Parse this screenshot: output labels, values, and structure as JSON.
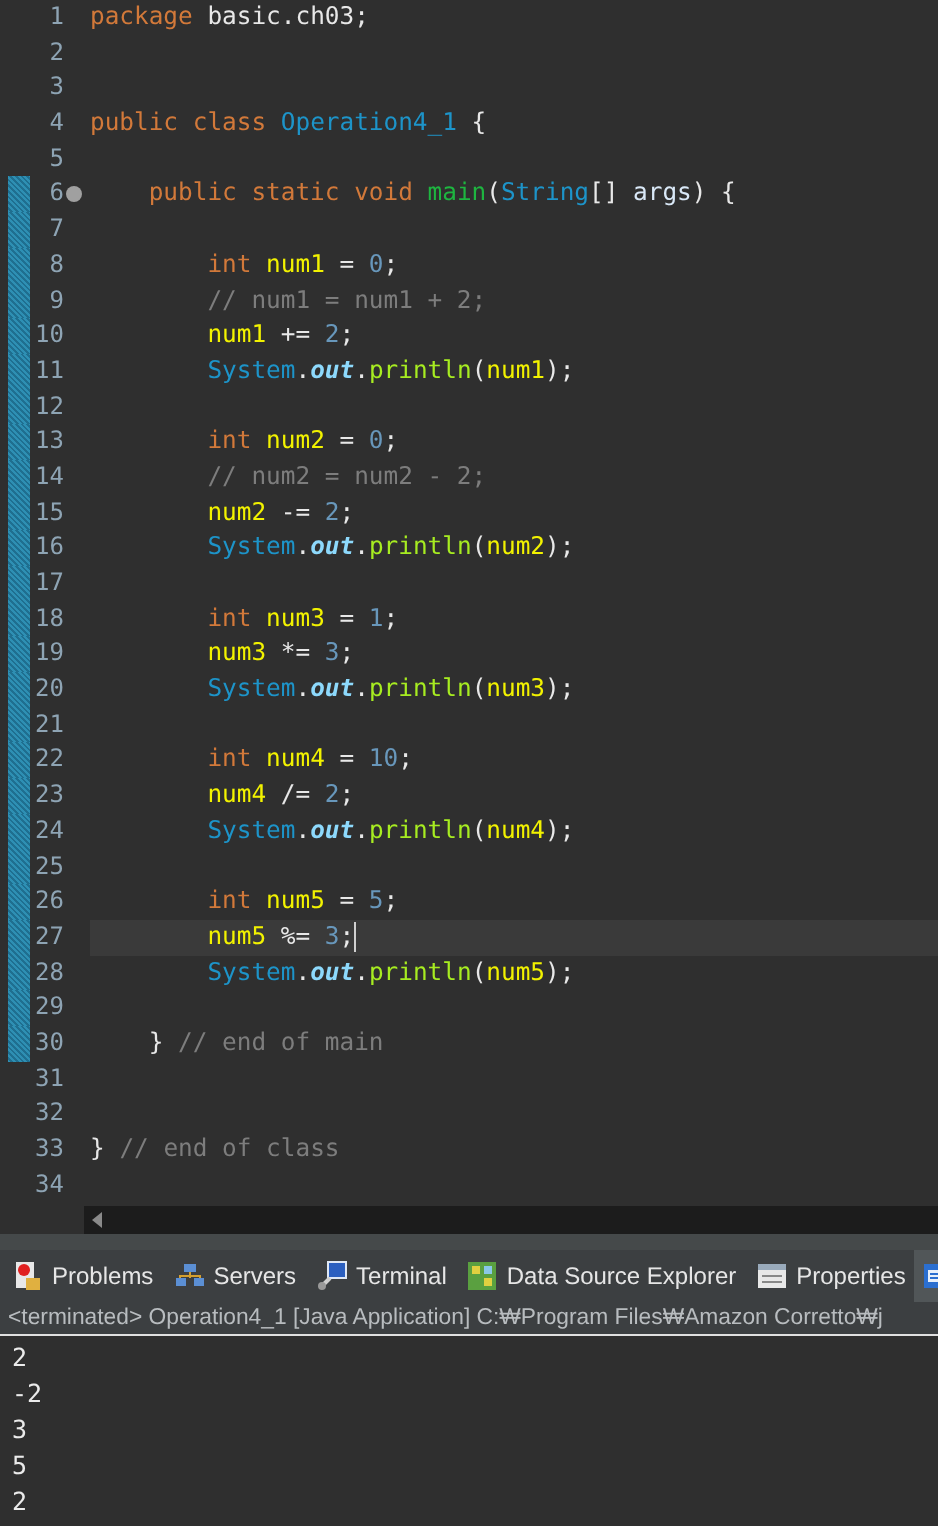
{
  "editor": {
    "lines": [
      {
        "number": "1",
        "changed": false,
        "tokens": [
          {
            "kind": "kw",
            "text": "package"
          },
          {
            "kind": "plain",
            "text": " basic.ch03;"
          }
        ]
      },
      {
        "number": "2",
        "changed": false
      },
      {
        "number": "3",
        "changed": false
      },
      {
        "number": "4",
        "changed": false,
        "tokens": [
          {
            "kind": "kw",
            "text": "public class"
          },
          {
            "kind": "type",
            "text": " Operation4_1"
          },
          {
            "kind": "plain",
            "text": " {"
          }
        ]
      },
      {
        "number": "5",
        "changed": false
      },
      {
        "number": "6",
        "changed": true,
        "foldable": true,
        "tokens": [
          {
            "kind": "kw",
            "text": "    public static void"
          },
          {
            "kind": "method",
            "text": " main"
          },
          {
            "kind": "plain",
            "text": "("
          },
          {
            "kind": "type",
            "text": "String"
          },
          {
            "kind": "plain",
            "text": "[] "
          },
          {
            "kind": "param",
            "text": "args"
          },
          {
            "kind": "plain",
            "text": ") {"
          }
        ]
      },
      {
        "number": "7",
        "changed": true
      },
      {
        "number": "8",
        "changed": true,
        "tokens": [
          {
            "kind": "kw",
            "text": "        int"
          },
          {
            "kind": "var",
            "text": " num1"
          },
          {
            "kind": "plain",
            "text": " = "
          },
          {
            "kind": "num",
            "text": "0"
          },
          {
            "kind": "plain",
            "text": ";"
          }
        ]
      },
      {
        "number": "9",
        "changed": true,
        "tokens": [
          {
            "kind": "comment",
            "text": "        // num1 = num1 + 2;"
          }
        ]
      },
      {
        "number": "10",
        "changed": true,
        "tokens": [
          {
            "kind": "var",
            "text": "        num1"
          },
          {
            "kind": "plain",
            "text": " += "
          },
          {
            "kind": "num",
            "text": "2"
          },
          {
            "kind": "plain",
            "text": ";"
          }
        ]
      },
      {
        "number": "11",
        "changed": true,
        "tokens": [
          {
            "kind": "type",
            "text": "        System"
          },
          {
            "kind": "plain",
            "text": "."
          },
          {
            "kind": "field",
            "text": "out"
          },
          {
            "kind": "plain",
            "text": "."
          },
          {
            "kind": "call",
            "text": "println"
          },
          {
            "kind": "plain",
            "text": "("
          },
          {
            "kind": "var",
            "text": "num1"
          },
          {
            "kind": "plain",
            "text": ");"
          }
        ]
      },
      {
        "number": "12",
        "changed": true
      },
      {
        "number": "13",
        "changed": true,
        "tokens": [
          {
            "kind": "kw",
            "text": "        int"
          },
          {
            "kind": "var",
            "text": " num2"
          },
          {
            "kind": "plain",
            "text": " = "
          },
          {
            "kind": "num",
            "text": "0"
          },
          {
            "kind": "plain",
            "text": ";"
          }
        ]
      },
      {
        "number": "14",
        "changed": true,
        "tokens": [
          {
            "kind": "comment",
            "text": "        // num2 = num2 - 2;"
          }
        ]
      },
      {
        "number": "15",
        "changed": true,
        "tokens": [
          {
            "kind": "var",
            "text": "        num2"
          },
          {
            "kind": "plain",
            "text": " -= "
          },
          {
            "kind": "num",
            "text": "2"
          },
          {
            "kind": "plain",
            "text": ";"
          }
        ]
      },
      {
        "number": "16",
        "changed": true,
        "tokens": [
          {
            "kind": "type",
            "text": "        System"
          },
          {
            "kind": "plain",
            "text": "."
          },
          {
            "kind": "field",
            "text": "out"
          },
          {
            "kind": "plain",
            "text": "."
          },
          {
            "kind": "call",
            "text": "println"
          },
          {
            "kind": "plain",
            "text": "("
          },
          {
            "kind": "var",
            "text": "num2"
          },
          {
            "kind": "plain",
            "text": ");"
          }
        ]
      },
      {
        "number": "17",
        "changed": true
      },
      {
        "number": "18",
        "changed": true,
        "tokens": [
          {
            "kind": "kw",
            "text": "        int"
          },
          {
            "kind": "var",
            "text": " num3"
          },
          {
            "kind": "plain",
            "text": " = "
          },
          {
            "kind": "num",
            "text": "1"
          },
          {
            "kind": "plain",
            "text": ";"
          }
        ]
      },
      {
        "number": "19",
        "changed": true,
        "tokens": [
          {
            "kind": "var",
            "text": "        num3"
          },
          {
            "kind": "plain",
            "text": " *= "
          },
          {
            "kind": "num",
            "text": "3"
          },
          {
            "kind": "plain",
            "text": ";"
          }
        ]
      },
      {
        "number": "20",
        "changed": true,
        "tokens": [
          {
            "kind": "type",
            "text": "        System"
          },
          {
            "kind": "plain",
            "text": "."
          },
          {
            "kind": "field",
            "text": "out"
          },
          {
            "kind": "plain",
            "text": "."
          },
          {
            "kind": "call",
            "text": "println"
          },
          {
            "kind": "plain",
            "text": "("
          },
          {
            "kind": "var",
            "text": "num3"
          },
          {
            "kind": "plain",
            "text": ");"
          }
        ]
      },
      {
        "number": "21",
        "changed": true
      },
      {
        "number": "22",
        "changed": true,
        "tokens": [
          {
            "kind": "kw",
            "text": "        int"
          },
          {
            "kind": "var",
            "text": " num4"
          },
          {
            "kind": "plain",
            "text": " = "
          },
          {
            "kind": "num",
            "text": "10"
          },
          {
            "kind": "plain",
            "text": ";"
          }
        ]
      },
      {
        "number": "23",
        "changed": true,
        "tokens": [
          {
            "kind": "var",
            "text": "        num4"
          },
          {
            "kind": "plain",
            "text": " /= "
          },
          {
            "kind": "num",
            "text": "2"
          },
          {
            "kind": "plain",
            "text": ";"
          }
        ]
      },
      {
        "number": "24",
        "changed": true,
        "tokens": [
          {
            "kind": "type",
            "text": "        System"
          },
          {
            "kind": "plain",
            "text": "."
          },
          {
            "kind": "field",
            "text": "out"
          },
          {
            "kind": "plain",
            "text": "."
          },
          {
            "kind": "call",
            "text": "println"
          },
          {
            "kind": "plain",
            "text": "("
          },
          {
            "kind": "var",
            "text": "num4"
          },
          {
            "kind": "plain",
            "text": ");"
          }
        ]
      },
      {
        "number": "25",
        "changed": true
      },
      {
        "number": "26",
        "changed": true,
        "tokens": [
          {
            "kind": "kw",
            "text": "        int"
          },
          {
            "kind": "var",
            "text": " num5"
          },
          {
            "kind": "plain",
            "text": " = "
          },
          {
            "kind": "num",
            "text": "5"
          },
          {
            "kind": "plain",
            "text": ";"
          }
        ]
      },
      {
        "number": "27",
        "changed": true,
        "current": true,
        "tokens": [
          {
            "kind": "var",
            "text": "        num5"
          },
          {
            "kind": "plain",
            "text": " %= "
          },
          {
            "kind": "num",
            "text": "3"
          },
          {
            "kind": "plain",
            "text": ";"
          }
        ]
      },
      {
        "number": "28",
        "changed": true,
        "tokens": [
          {
            "kind": "type",
            "text": "        System"
          },
          {
            "kind": "plain",
            "text": "."
          },
          {
            "kind": "field",
            "text": "out"
          },
          {
            "kind": "plain",
            "text": "."
          },
          {
            "kind": "call",
            "text": "println"
          },
          {
            "kind": "plain",
            "text": "("
          },
          {
            "kind": "var",
            "text": "num5"
          },
          {
            "kind": "plain",
            "text": ");"
          }
        ]
      },
      {
        "number": "29",
        "changed": true
      },
      {
        "number": "30",
        "changed": true,
        "tokens": [
          {
            "kind": "plain",
            "text": "    } "
          },
          {
            "kind": "comment",
            "text": "// end of main"
          }
        ]
      },
      {
        "number": "31",
        "changed": false
      },
      {
        "number": "32",
        "changed": false
      },
      {
        "number": "33",
        "changed": false,
        "tokens": [
          {
            "kind": "plain",
            "text": "} "
          },
          {
            "kind": "comment",
            "text": "// end of class"
          }
        ]
      },
      {
        "number": "34",
        "changed": false
      }
    ]
  },
  "view_tabs": [
    {
      "label": "Problems",
      "selected": false
    },
    {
      "label": "Servers",
      "selected": false
    },
    {
      "label": "Terminal",
      "selected": false
    },
    {
      "label": "Data Source Explorer",
      "selected": false
    },
    {
      "label": "Properties",
      "selected": false
    },
    {
      "selected": true
    }
  ],
  "console": {
    "header": "<terminated> Operation4_1 [Java Application] C:₩Program Files₩Amazon Corretto₩j",
    "output": [
      "2",
      "-2",
      "3",
      "5",
      "2"
    ]
  }
}
